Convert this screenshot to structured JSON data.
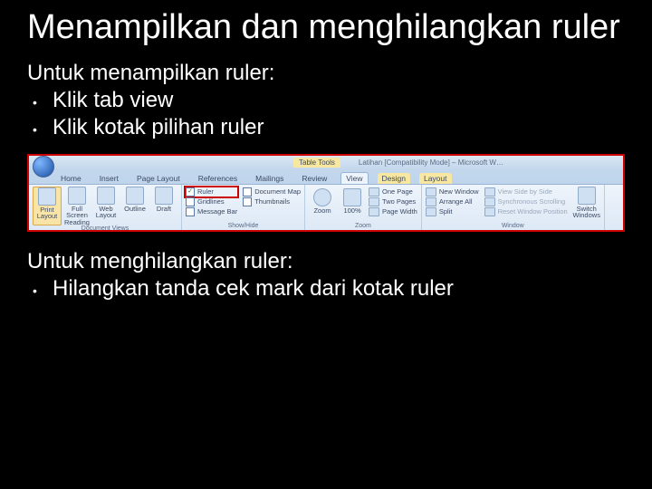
{
  "heading": "Menampilkan dan menghilangkan ruler",
  "show": {
    "intro": "Untuk menampilkan ruler:",
    "b1": "Klik tab view",
    "b2": "Klik kotak pilihan ruler"
  },
  "hide": {
    "intro": "Untuk menghilangkan ruler:",
    "b1": "Hilangkan tanda cek mark dari kotak ruler"
  },
  "ribbon": {
    "table_tools": "Table Tools",
    "doc_title": "Latihan [Compatibility Mode] – Microsoft W…",
    "tabs": {
      "home": "Home",
      "insert": "Insert",
      "page_layout": "Page Layout",
      "references": "References",
      "mailings": "Mailings",
      "review": "Review",
      "view": "View",
      "design": "Design",
      "layout": "Layout"
    },
    "groups": {
      "document_views": "Document Views",
      "show_hide": "Show/Hide",
      "zoom": "Zoom",
      "window": "Window"
    },
    "views": {
      "print": "Print Layout",
      "full": "Full Screen Reading",
      "web": "Web Layout",
      "outline": "Outline",
      "draft": "Draft"
    },
    "showhide": {
      "ruler": "Ruler",
      "gridlines": "Gridlines",
      "message_bar": "Message Bar",
      "document_map": "Document Map",
      "thumbnails": "Thumbnails"
    },
    "zoom": {
      "zoom": "Zoom",
      "pct": "100%",
      "one_page": "One Page",
      "two_pages": "Two Pages",
      "page_width": "Page Width"
    },
    "window": {
      "new_window": "New Window",
      "arrange_all": "Arrange All",
      "split": "Split",
      "side_by_side": "View Side by Side",
      "sync": "Synchronous Scrolling",
      "reset": "Reset Window Position",
      "switch": "Switch Windows"
    }
  }
}
